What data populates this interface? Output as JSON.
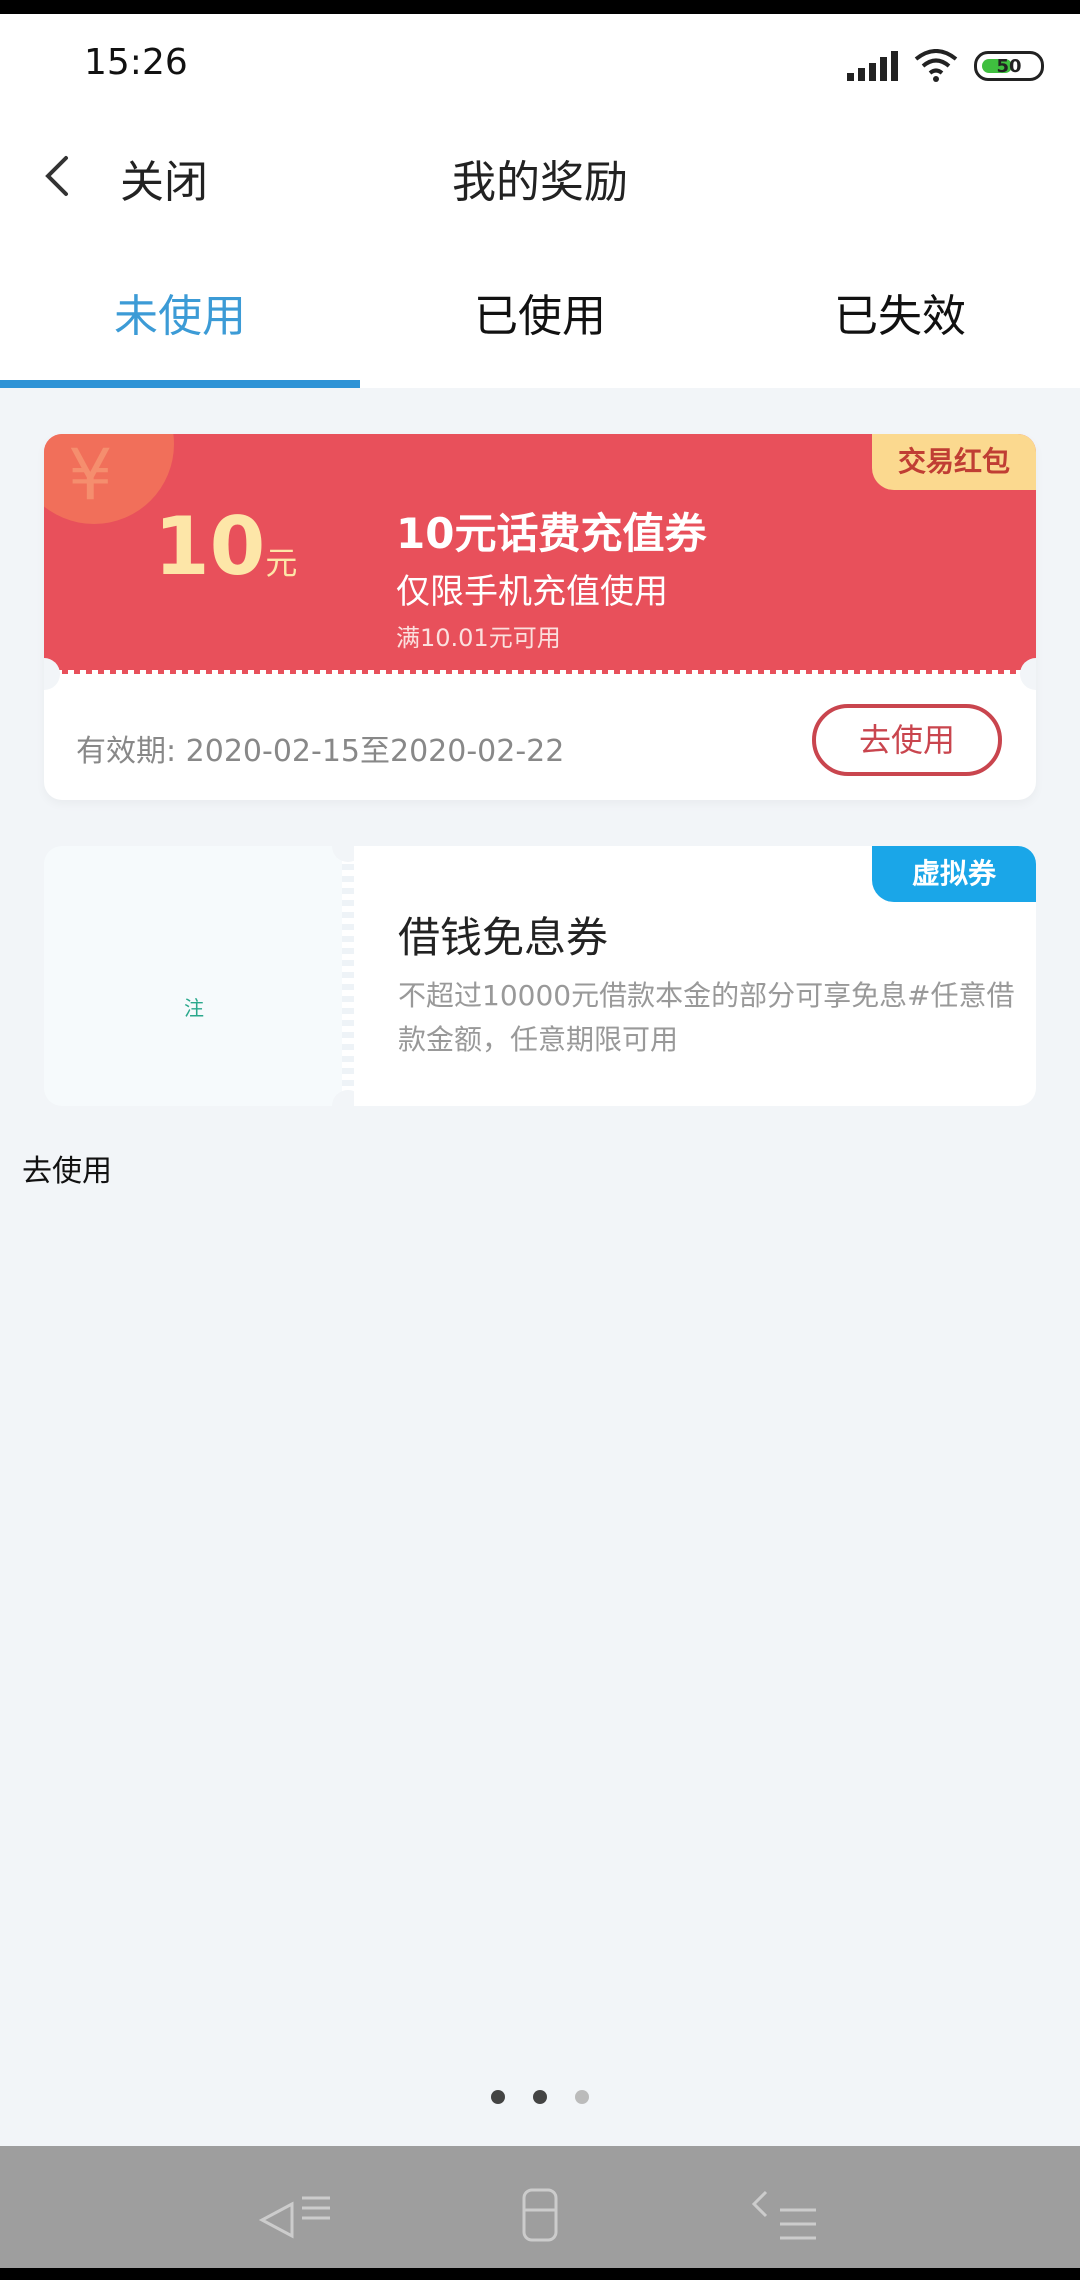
{
  "status_bar": {
    "time": "15:26",
    "battery": "50"
  },
  "header": {
    "close_label": "关闭",
    "title": "我的奖励"
  },
  "tabs": [
    {
      "label": "未使用",
      "active": true
    },
    {
      "label": "已使用",
      "active": false
    },
    {
      "label": "已失效",
      "active": false
    }
  ],
  "coupons": [
    {
      "badge": "交易红包",
      "yen": "¥",
      "amount": "10",
      "unit": "元",
      "name": "10元话费充值券",
      "desc": "仅限手机充值使用",
      "condition": "满10.01元可用",
      "validity": "有效期: 2020-02-15至2020-02-22",
      "action": "去使用"
    },
    {
      "badge": "虚拟券",
      "left_mark": "注",
      "name": "借钱免息券",
      "desc": "不超过10000元借款本金的部分可享免息#任意借款金额，任意期限可用"
    }
  ],
  "loose_action": "去使用",
  "colors": {
    "accent": "#2f93d6",
    "coupon_red": "#e8505b",
    "badge_gold": "#fbd98f",
    "badge_blue": "#1aa6e8"
  }
}
